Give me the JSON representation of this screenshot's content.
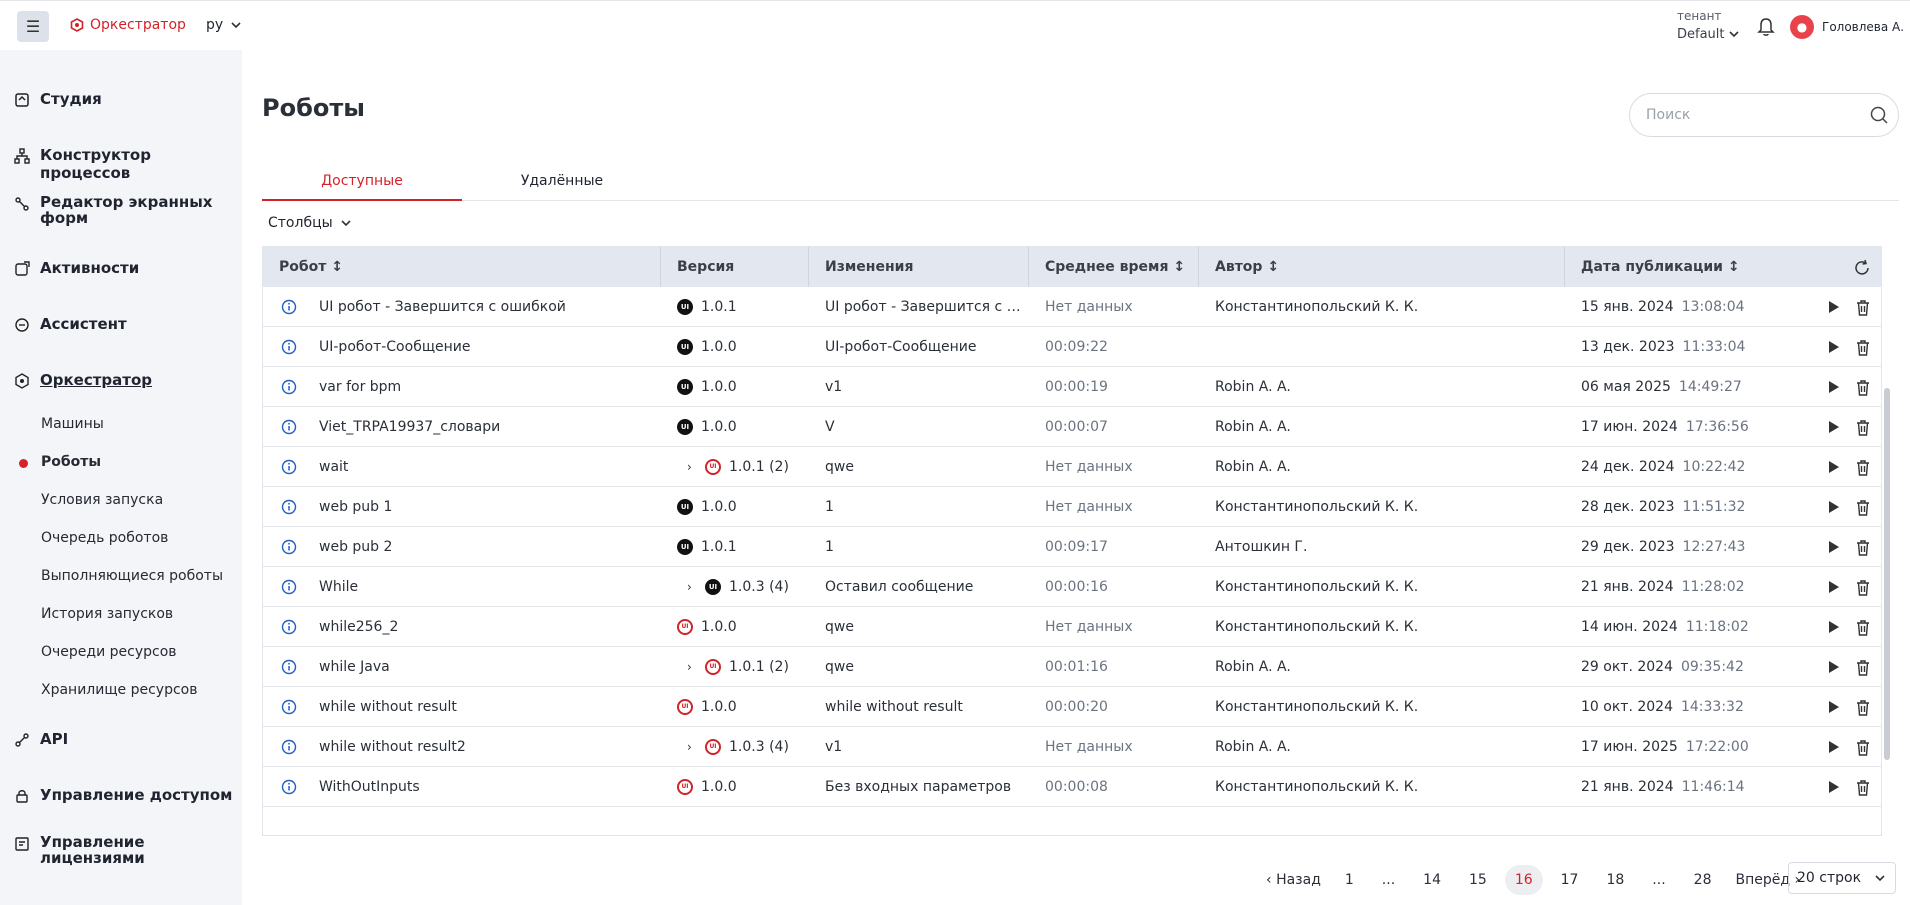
{
  "header": {
    "menu_icon": "hamburger-icon",
    "brand": "Оркестратор",
    "lang": "ру",
    "tenant_label": "тенант",
    "tenant_value": "Default",
    "user_name": "Головлева А."
  },
  "sidebar": {
    "items": [
      {
        "label": "Студия",
        "icon": "studio-icon"
      },
      {
        "label": "Конструктор процессов",
        "icon": "process-icon"
      },
      {
        "label": "Редактор экранных форм",
        "icon": "forms-icon"
      },
      {
        "label": "Активности",
        "icon": "activities-icon"
      },
      {
        "label": "Ассистент",
        "icon": "assistant-icon"
      },
      {
        "label": "Оркестратор",
        "icon": "orchestrator-icon"
      },
      {
        "label": "API",
        "icon": "api-icon"
      },
      {
        "label": "Управление доступом",
        "icon": "access-icon"
      },
      {
        "label": "Управление лицензиями",
        "icon": "license-icon"
      }
    ],
    "sub_items": [
      "Машины",
      "Роботы",
      "Условия запуска",
      "Очередь роботов",
      "Выполняющиеся роботы",
      "История запусков",
      "Очереди ресурсов",
      "Хранилище ресурсов"
    ]
  },
  "page": {
    "title": "Роботы",
    "search_placeholder": "Поиск",
    "tabs": [
      "Доступные",
      "Удалённые"
    ],
    "columns_label": "Столбцы"
  },
  "table": {
    "headers": [
      "Робот",
      "Версия",
      "Изменения",
      "Среднее время",
      "Автор",
      "Дата публикации"
    ],
    "rows": [
      {
        "name": "UI робот - Завершится с ошибкой",
        "expand": false,
        "badge": "dark",
        "version": "1.0.1",
        "changes": "UI робот - Завершится с ошибкой",
        "avg": "Нет данных",
        "author": "Константинопольский К. К.",
        "date": "15 янв. 2024",
        "time": "13:08:04"
      },
      {
        "name": "UI-робот-Сообщение",
        "expand": false,
        "badge": "dark",
        "version": "1.0.0",
        "changes": "UI-робот-Сообщение",
        "avg": "00:09:22",
        "author": "",
        "date": "13 дек. 2023",
        "time": "11:33:04"
      },
      {
        "name": "var for bpm",
        "expand": false,
        "badge": "dark",
        "version": "1.0.0",
        "changes": "v1",
        "avg": "00:00:19",
        "author": "Robin A. A.",
        "date": "06 мая 2025",
        "time": "14:49:27"
      },
      {
        "name": "Viet_TRPA19937_словари",
        "expand": false,
        "badge": "dark",
        "version": "1.0.0",
        "changes": "V",
        "avg": "00:00:07",
        "author": "Robin A. A.",
        "date": "17 июн. 2024",
        "time": "17:36:56"
      },
      {
        "name": "wait",
        "expand": true,
        "badge": "red",
        "version": "1.0.1 (2)",
        "changes": "qwe",
        "avg": "Нет данных",
        "author": "Robin A. A.",
        "date": "24 дек. 2024",
        "time": "10:22:42"
      },
      {
        "name": "web pub 1",
        "expand": false,
        "badge": "dark",
        "version": "1.0.0",
        "changes": "1",
        "avg": "Нет данных",
        "author": "Константинопольский К. К.",
        "date": "28 дек. 2023",
        "time": "11:51:32"
      },
      {
        "name": "web pub 2",
        "expand": false,
        "badge": "dark",
        "version": "1.0.1",
        "changes": "1",
        "avg": "00:09:17",
        "author": "Антошкин Г.",
        "date": "29 дек. 2023",
        "time": "12:27:43"
      },
      {
        "name": "While",
        "expand": true,
        "badge": "dark",
        "version": "1.0.3 (4)",
        "changes": "Оставил сообщение",
        "avg": "00:00:16",
        "author": "Константинопольский К. К.",
        "date": "21 янв. 2024",
        "time": "11:28:02"
      },
      {
        "name": "while256_2",
        "expand": false,
        "badge": "red",
        "version": "1.0.0",
        "changes": "qwe",
        "avg": "Нет данных",
        "author": "Константинопольский К. К.",
        "date": "14 июн. 2024",
        "time": "11:18:02"
      },
      {
        "name": "while Java",
        "expand": true,
        "badge": "red",
        "version": "1.0.1 (2)",
        "changes": "qwe",
        "avg": "00:01:16",
        "author": "Robin A. A.",
        "date": "29 окт. 2024",
        "time": "09:35:42"
      },
      {
        "name": "while without result",
        "expand": false,
        "badge": "red",
        "version": "1.0.0",
        "changes": "while without result",
        "avg": "00:00:20",
        "author": "Константинопольский К. К.",
        "date": "10 окт. 2024",
        "time": "14:33:32"
      },
      {
        "name": "while without result2",
        "expand": true,
        "badge": "red",
        "version": "1.0.3 (4)",
        "changes": "v1",
        "avg": "Нет данных",
        "author": "Robin A. A.",
        "date": "17 июн. 2025",
        "time": "17:22:00"
      },
      {
        "name": "WithOutInputs",
        "expand": false,
        "badge": "red",
        "version": "1.0.0",
        "changes": "Без входных параметров",
        "avg": "00:00:08",
        "author": "Константинопольский К. К.",
        "date": "21 янв. 2024",
        "time": "11:46:14"
      }
    ]
  },
  "pager": {
    "prev": "Назад",
    "next": "Вперёд",
    "pages": [
      "1",
      "...",
      "14",
      "15",
      "16",
      "17",
      "18",
      "...",
      "28"
    ],
    "current": "16",
    "rows_per_page": "20 строк"
  }
}
